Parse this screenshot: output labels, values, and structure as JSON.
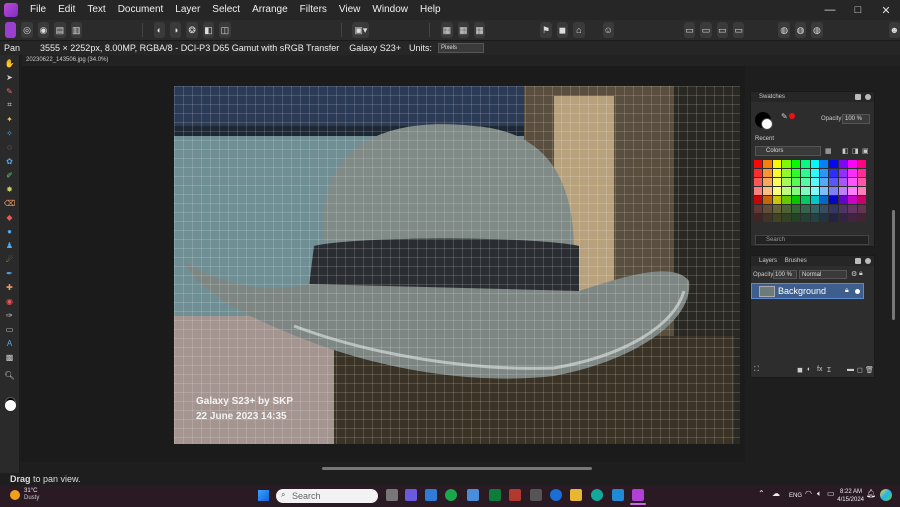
{
  "menubar": {
    "items": [
      "File",
      "Edit",
      "Text",
      "Document",
      "Layer",
      "Select",
      "Arrange",
      "Filters",
      "View",
      "Window",
      "Help"
    ]
  },
  "window_controls": {
    "minimize": "—",
    "restore": "□",
    "close": "✕"
  },
  "context_bar": {
    "tool_name": "Pan",
    "info": "3555 × 2252px, 8.00MP, RGBA/8 - DCI-P3 D65 Gamut with sRGB Transfer",
    "device": "Galaxy S23+",
    "units_label": "Units:",
    "units_value": "Pixels"
  },
  "document_tab": {
    "title": "20230622_143506.jpg (34.0%)"
  },
  "canvas": {
    "watermark_line1": "Galaxy S23+ by SKP",
    "watermark_line2": "22 June 2023 14:35"
  },
  "status": {
    "bold": "Drag",
    "text": " to pan view."
  },
  "swatches_panel": {
    "tab": "Swatches",
    "opacity_label": "Opacity:",
    "opacity_value": "100 %",
    "recent_label": "Recent",
    "palette_name": "Colors",
    "search_placeholder": "Search"
  },
  "layers_panel": {
    "tabs": [
      "Layers",
      "Brushes"
    ],
    "opacity_label": "Opacity:",
    "opacity_value": "100 %",
    "blend_mode": "Normal",
    "layer_name": "Background"
  },
  "taskbar": {
    "weather_temp": "31°C",
    "weather_desc": "Dusty",
    "search_placeholder": "Search",
    "language": "ENG",
    "time": "8:22 AM",
    "date": "4/15/2024"
  },
  "colors": {
    "accent": "#3e5f8e",
    "app_purple": "#9b3fd0",
    "arrow_yellow": "#f2e600"
  }
}
